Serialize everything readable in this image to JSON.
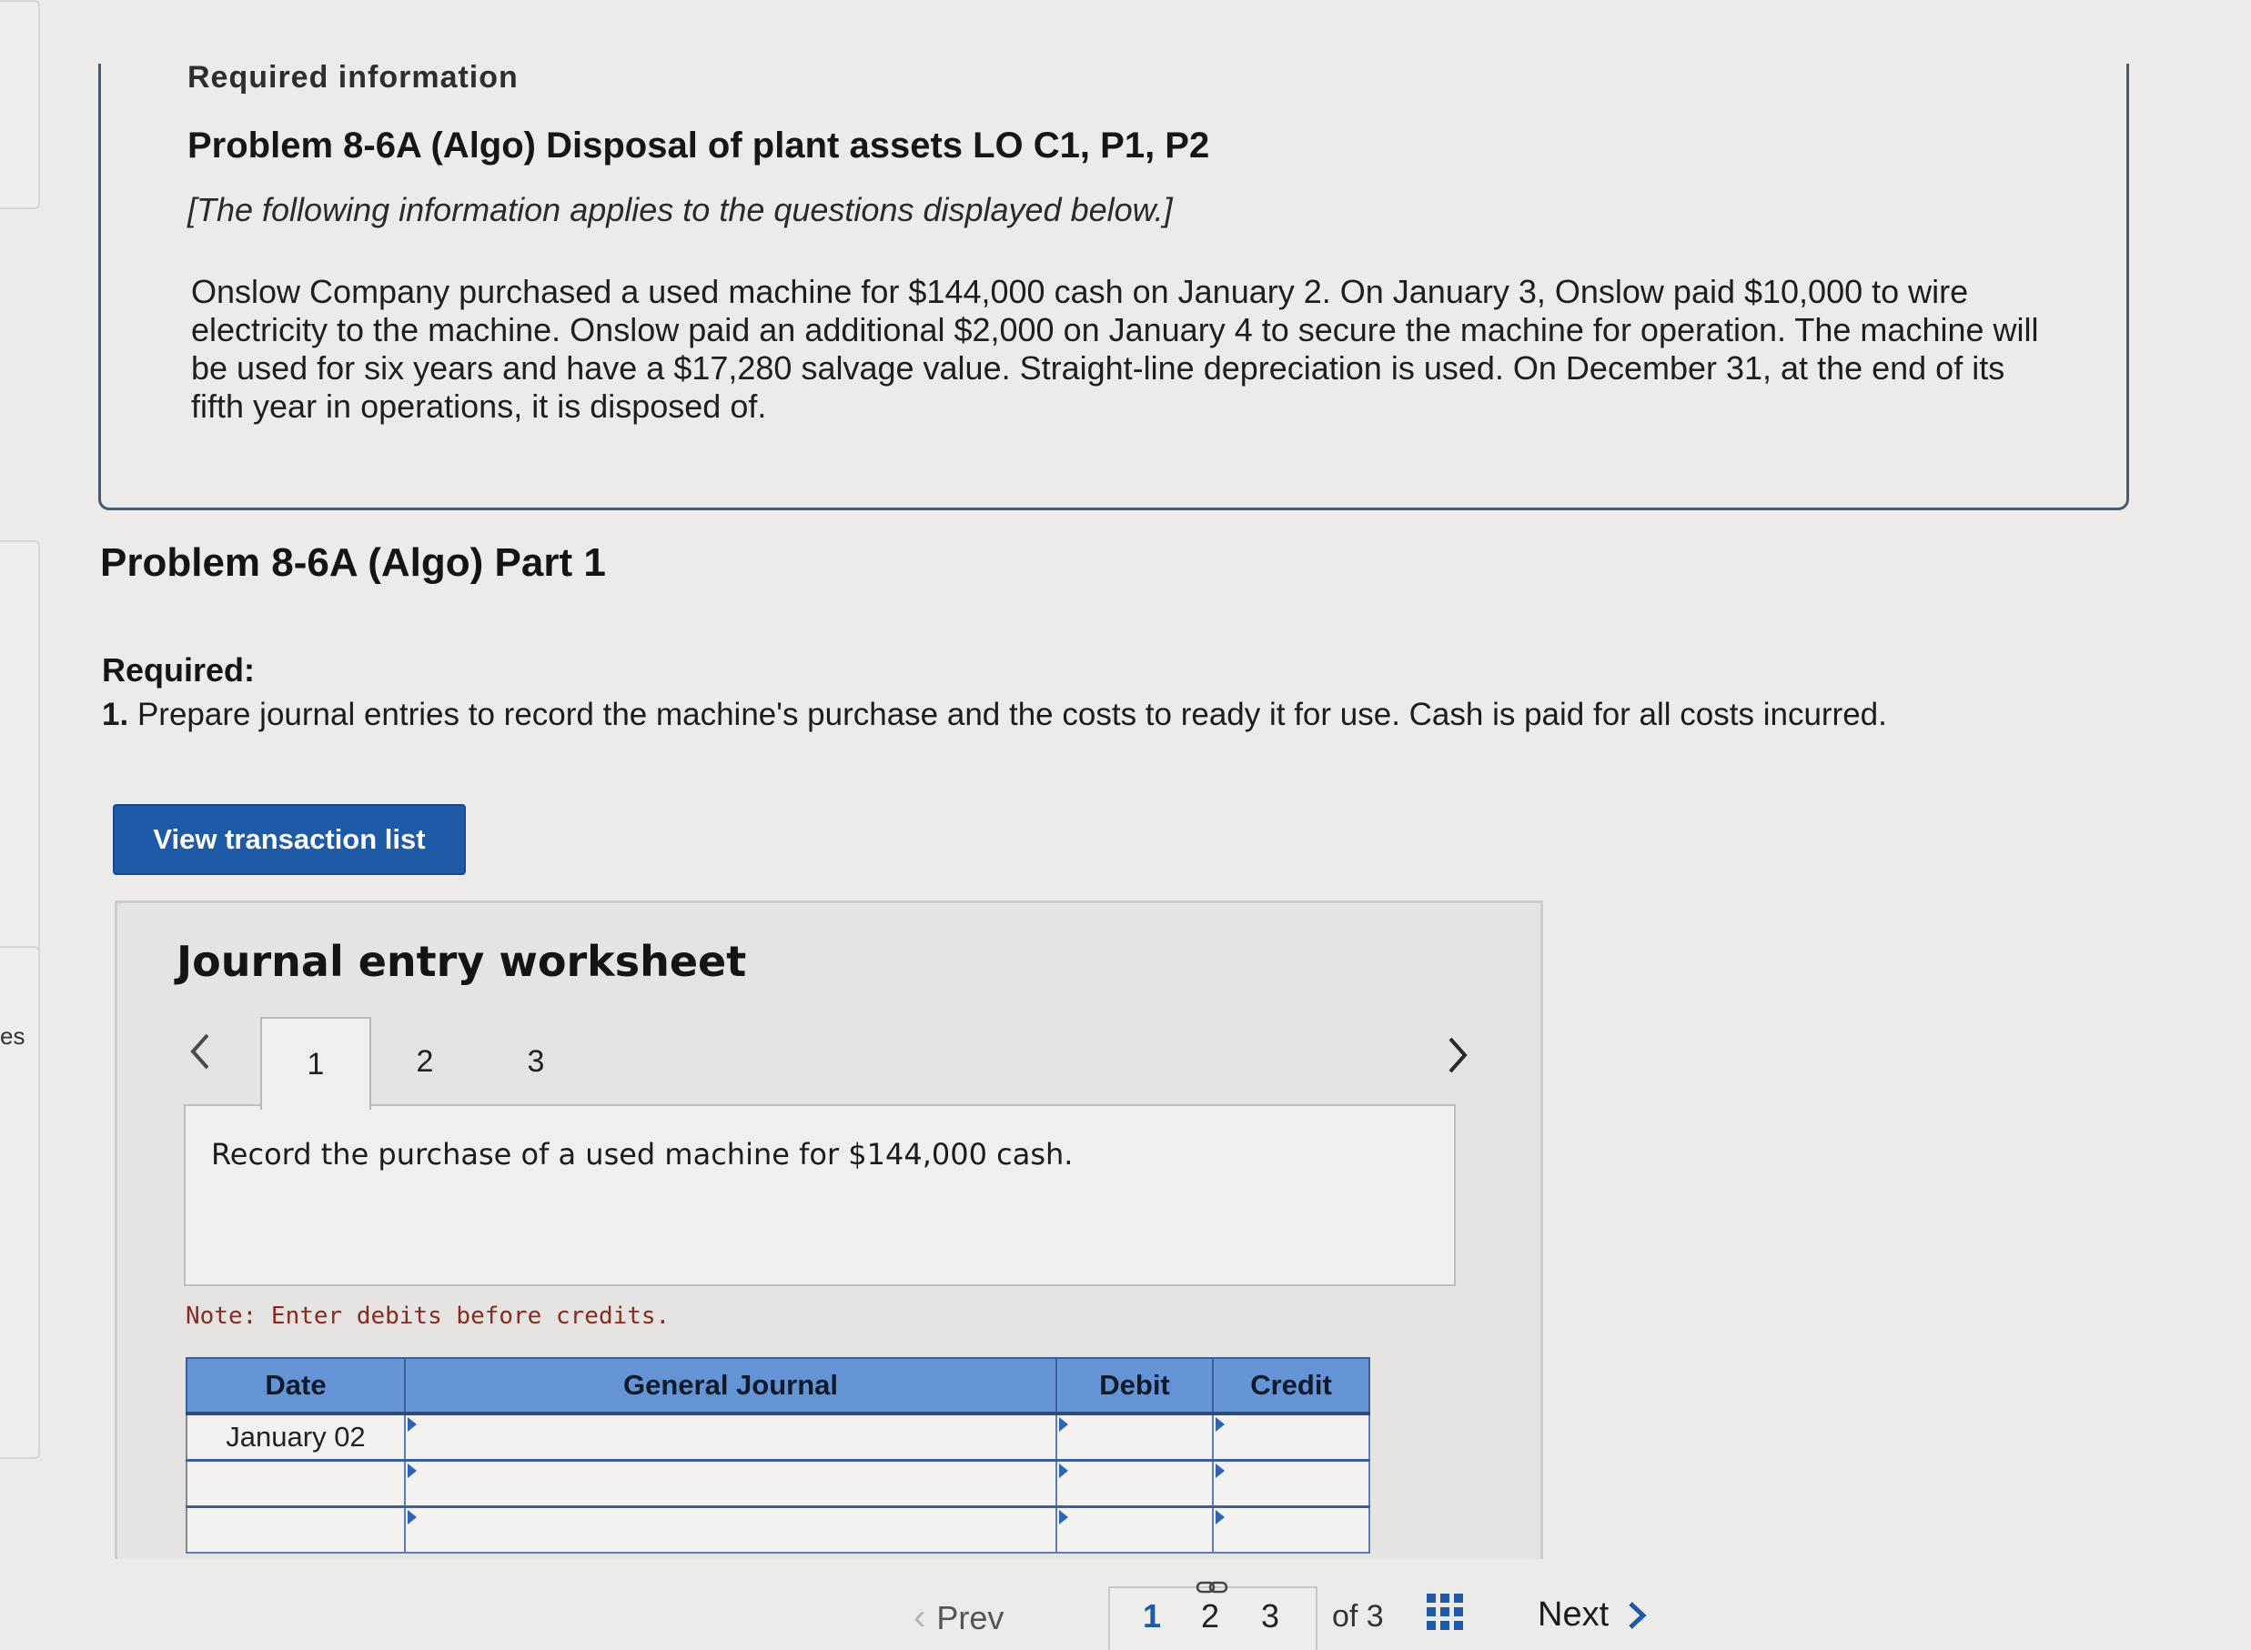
{
  "side": {
    "partial_text": "es"
  },
  "info": {
    "label": "Required information",
    "problem_title": "Problem 8-6A (Algo) Disposal of plant assets LO C1, P1, P2",
    "intro": "[The following information applies to the questions displayed below.]",
    "scenario": "Onslow Company purchased a used machine for $144,000 cash on January 2. On January 3, Onslow paid $10,000 to wire electricity to the machine. Onslow paid an additional $2,000 on January 4 to secure the machine for operation. The machine will be used for six years and have a $17,280 salvage value. Straight-line depreciation is used. On December 31, at the end of its fifth year in operations, it is disposed of."
  },
  "part": {
    "title": "Problem 8-6A (Algo) Part 1",
    "required_label": "Required:",
    "required_number": "1.",
    "required_text": "Prepare journal entries to record the machine's purchase and the costs to ready it for use. Cash is paid for all costs incurred."
  },
  "buttons": {
    "view_transactions": "View transaction list"
  },
  "worksheet": {
    "title": "Journal entry worksheet",
    "tabs": [
      "1",
      "2",
      "3"
    ],
    "active_tab": "1",
    "prompt": "Record the purchase of a used machine for $144,000 cash.",
    "note": "Note: Enter debits before credits.",
    "table": {
      "headers": [
        "Date",
        "General Journal",
        "Debit",
        "Credit"
      ],
      "rows": [
        {
          "date": "January 02",
          "account": "",
          "debit": "",
          "credit": ""
        },
        {
          "date": "",
          "account": "",
          "debit": "",
          "credit": ""
        },
        {
          "date": "",
          "account": "",
          "debit": "",
          "credit": ""
        }
      ]
    }
  },
  "pagination": {
    "prev": "Prev",
    "pages": [
      "1",
      "2",
      "3"
    ],
    "current_page": "1",
    "of_text": "of 3",
    "next": "Next"
  },
  "colors": {
    "accent": "#1f5aa6",
    "table_header": "#6493d6",
    "note_text": "#8a2a1c"
  }
}
